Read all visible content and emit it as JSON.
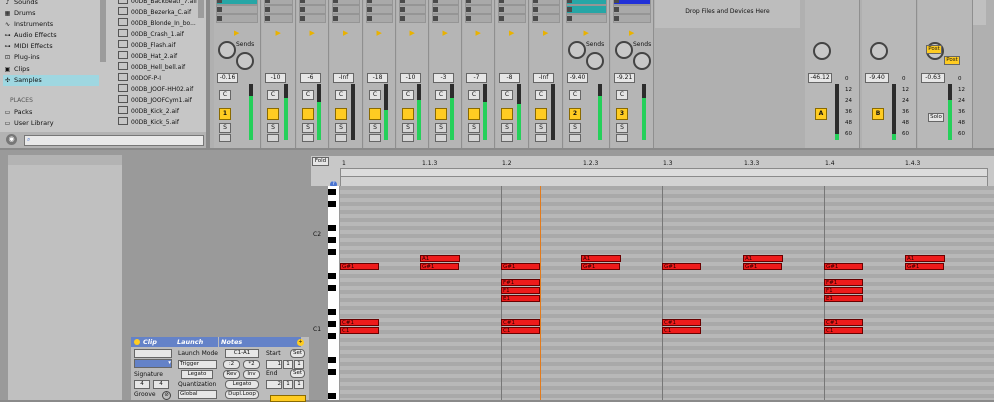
{
  "browser": {
    "categories": [
      {
        "label": "Sounds",
        "icon": "sounds-icon",
        "glyph": "♪"
      },
      {
        "label": "Drums",
        "icon": "drums-icon",
        "glyph": "▦"
      },
      {
        "label": "Instruments",
        "icon": "instruments-icon",
        "glyph": "∿"
      },
      {
        "label": "Audio Effects",
        "icon": "audio-effects-icon",
        "glyph": "⊶"
      },
      {
        "label": "MIDI Effects",
        "icon": "midi-effects-icon",
        "glyph": "⊶"
      },
      {
        "label": "Plug-ins",
        "icon": "plugins-icon",
        "glyph": "⊡"
      },
      {
        "label": "Clips",
        "icon": "clips-icon",
        "glyph": "▣"
      },
      {
        "label": "Samples",
        "icon": "samples-icon",
        "glyph": "✣"
      }
    ],
    "places_heading": "PLACES",
    "places": [
      {
        "label": "Packs",
        "icon": "packs-icon",
        "glyph": "▭"
      },
      {
        "label": "User Library",
        "icon": "user-library-icon",
        "glyph": "▭"
      }
    ],
    "files": [
      "00DB_Backbeatr_7.aif",
      "00DB_Bezerka_C.aif",
      "00DB_Blonde_In_bo...",
      "00DB_Crash_1.aif",
      "00DB_Flash.aif",
      "00DB_Hat_2.aif",
      "00DB_Hell_bell.aif",
      "00DOF-P-I",
      "00DB_JOOF-HH02.aif",
      "00DB_JOOFCym1.aif",
      "00DB_Kick_2.aif",
      "00DB_Kick_5.aif"
    ],
    "search_placeholder": ""
  },
  "mixer": {
    "drop_text": "Drop Files and Devices Here",
    "sends_label": "Sends",
    "post_label": "Post",
    "solo_label": "Solo",
    "scene_numbers": [
      "1",
      "2",
      "3"
    ],
    "send_a": "A",
    "send_b": "B",
    "track_volumes": [
      "-0.16",
      "-10",
      "-6",
      "-Inf",
      "-18",
      "-10",
      "-3",
      "-7",
      "-8",
      "-Inf",
      "-9.40",
      "-9.21"
    ],
    "track_numbers": [
      "1",
      "",
      "",
      "",
      "",
      "",
      "",
      "",
      "",
      "",
      "2",
      "3"
    ],
    "return_volumes": [
      "-46.12",
      "-9.40",
      "-0.63"
    ],
    "return_labels": [
      "A",
      "B",
      ""
    ],
    "meter_scale": [
      "0",
      "12",
      "24",
      "36",
      "48",
      "60"
    ],
    "io_2": "2",
    "io_4": "4",
    "c_label": "C",
    "s_label": "S",
    "arm_label": "⏺"
  },
  "clip_view": {
    "clip_header": "Clip",
    "launch_header": "Launch",
    "notes_header": "Notes",
    "signature_label": "Signature",
    "sig_num": "4",
    "sig_den": "4",
    "groove_label": "Groove",
    "launch_mode_label": "Launch Mode",
    "launch_mode": "Trigger",
    "legato": "Legato",
    "quantization_label": "Quantization",
    "quantization": "Global",
    "notes_range": "C1-A1",
    "div2": ":2",
    "mul2": "*2",
    "rev": "Rev",
    "inv": "Inv",
    "dupl_loop": "Dupl.Loop",
    "start_label": "Start",
    "end_label": "End",
    "set_label": "Set",
    "start_vals": [
      "1",
      "1",
      "1"
    ],
    "end_vals": [
      "2",
      "1",
      "1"
    ]
  },
  "editor": {
    "fold_label": "Fold",
    "ruler": [
      "1",
      "1.1.3",
      "1.2",
      "1.2.3",
      "1.3",
      "1.3.3",
      "1.4",
      "1.4.3"
    ],
    "pitch_labels": [
      "C2",
      "C1"
    ],
    "notes": [
      {
        "label": "G#1",
        "col": 0,
        "row": "g1"
      },
      {
        "label": "A1",
        "col": 1,
        "row": "a1"
      },
      {
        "label": "G#1",
        "col": 1,
        "row": "g1"
      },
      {
        "label": "G#1",
        "col": 2,
        "row": "g1"
      },
      {
        "label": "A1",
        "col": 3,
        "row": "a1"
      },
      {
        "label": "G#1",
        "col": 3,
        "row": "g1"
      },
      {
        "label": "G#1",
        "col": 4,
        "row": "g1"
      },
      {
        "label": "A1",
        "col": 5,
        "row": "a1"
      },
      {
        "label": "G#1",
        "col": 5,
        "row": "g1"
      },
      {
        "label": "G#1",
        "col": 6,
        "row": "g1"
      },
      {
        "label": "A1",
        "col": 7,
        "row": "a1"
      },
      {
        "label": "G#1",
        "col": 7,
        "row": "g1"
      },
      {
        "label": "F#1",
        "col": 2,
        "row": "fs1"
      },
      {
        "label": "F1",
        "col": 2,
        "row": "f1"
      },
      {
        "label": "E1",
        "col": 2,
        "row": "e1"
      },
      {
        "label": "F#1",
        "col": 6,
        "row": "fs1"
      },
      {
        "label": "F1",
        "col": 6,
        "row": "f1"
      },
      {
        "label": "E1",
        "col": 6,
        "row": "e1"
      },
      {
        "label": "C#1",
        "col": 0,
        "row": "cs1"
      },
      {
        "label": "C1",
        "col": 0,
        "row": "c1"
      },
      {
        "label": "C#1",
        "col": 2,
        "row": "cs1"
      },
      {
        "label": "C1",
        "col": 2,
        "row": "c1"
      },
      {
        "label": "C#1",
        "col": 4,
        "row": "cs1"
      },
      {
        "label": "C1",
        "col": 4,
        "row": "c1"
      },
      {
        "label": "C#1",
        "col": 6,
        "row": "cs1"
      },
      {
        "label": "C1",
        "col": 6,
        "row": "c1"
      }
    ]
  },
  "colors": {
    "note": "#ee1b1b",
    "accent": "#ffcc22",
    "selected": "#9fd7e1",
    "header": "#6482c8",
    "meter": "#25d05a"
  }
}
